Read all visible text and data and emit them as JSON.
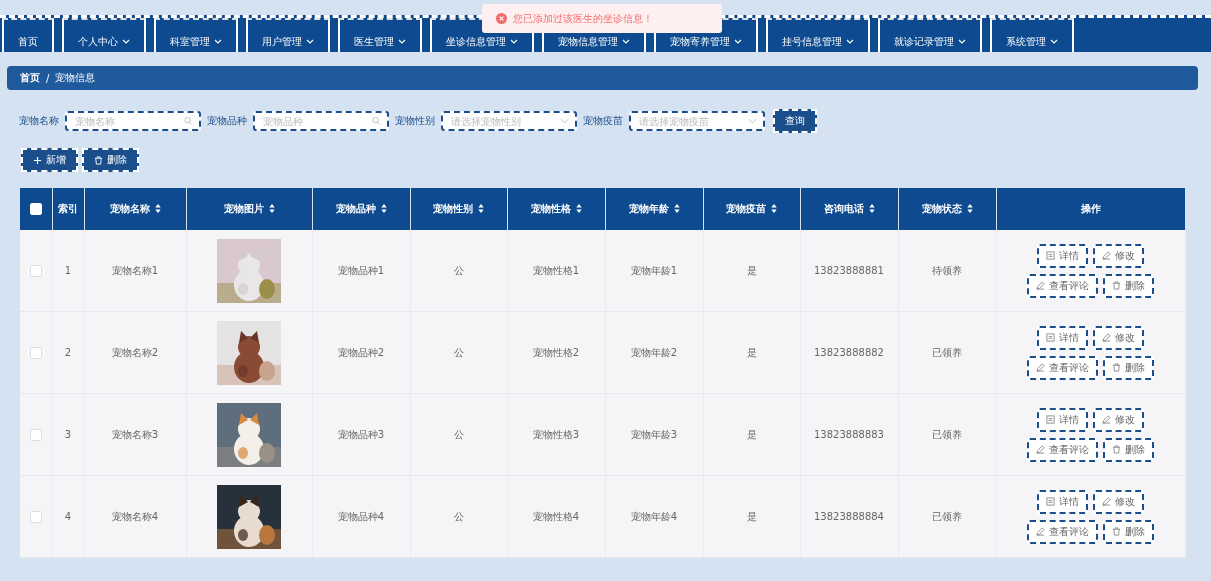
{
  "nav": [
    {
      "label": "首页",
      "has_menu": false
    },
    {
      "label": "个人中心",
      "has_menu": true
    },
    {
      "label": "科室管理",
      "has_menu": true
    },
    {
      "label": "用户管理",
      "has_menu": true
    },
    {
      "label": "医生管理",
      "has_menu": true
    },
    {
      "label": "坐诊信息管理",
      "has_menu": true
    },
    {
      "label": "宠物信息管理",
      "has_menu": true
    },
    {
      "label": "宠物寄养管理",
      "has_menu": true
    },
    {
      "label": "挂号信息管理",
      "has_menu": true
    },
    {
      "label": "就诊记录管理",
      "has_menu": true
    },
    {
      "label": "系统管理",
      "has_menu": true
    }
  ],
  "toast": {
    "kind": "error",
    "message": "您已添加过该医生的坐诊信息！"
  },
  "breadcrumb": {
    "items": [
      "首页",
      "宠物信息"
    ],
    "separator": "/"
  },
  "search": {
    "fields": [
      {
        "label": "宠物名称",
        "placeholder": "宠物名称",
        "kind": "text"
      },
      {
        "label": "宠物品种",
        "placeholder": "宠物品种",
        "kind": "text"
      },
      {
        "label": "宠物性别",
        "placeholder": "请选择宠物性别",
        "kind": "select"
      },
      {
        "label": "宠物疫苗",
        "placeholder": "请选择宠物疫苗",
        "kind": "select"
      }
    ],
    "button": "查询"
  },
  "actions": [
    "新增",
    "删除"
  ],
  "table": {
    "select_all": {
      "checked": false
    },
    "columns": [
      {
        "label": "索引",
        "sortable": false
      },
      {
        "label": "宠物名称",
        "sortable": true
      },
      {
        "label": "宠物图片",
        "sortable": true
      },
      {
        "label": "宠物品种",
        "sortable": true
      },
      {
        "label": "宠物性别",
        "sortable": true
      },
      {
        "label": "宠物性格",
        "sortable": true
      },
      {
        "label": "宠物年龄",
        "sortable": true
      },
      {
        "label": "宠物疫苗",
        "sortable": true
      },
      {
        "label": "咨询电话",
        "sortable": true
      },
      {
        "label": "宠物状态",
        "sortable": true
      },
      {
        "label": "操作",
        "sortable": false
      }
    ],
    "rows": [
      {
        "checked": false,
        "cells": [
          "1",
          "宠物名称1",
          {
            "kind": "picture"
          },
          "宠物品种1",
          "公",
          "宠物性格1",
          "宠物年龄1",
          "是",
          "13823888881",
          "待领养"
        ],
        "actions": [
          "详情",
          "修改",
          "查看评论",
          "删除"
        ]
      },
      {
        "checked": false,
        "cells": [
          "2",
          "宠物名称2",
          {
            "kind": "picture"
          },
          "宠物品种2",
          "公",
          "宠物性格2",
          "宠物年龄2",
          "是",
          "13823888882",
          "已领养"
        ],
        "actions": [
          "详情",
          "修改",
          "查看评论",
          "删除"
        ]
      },
      {
        "checked": false,
        "cells": [
          "3",
          "宠物名称3",
          {
            "kind": "picture"
          },
          "宠物品种3",
          "公",
          "宠物性格3",
          "宠物年龄3",
          "是",
          "13823888883",
          "已领养"
        ],
        "actions": [
          "详情",
          "修改",
          "查看评论",
          "删除"
        ]
      },
      {
        "checked": false,
        "cells": [
          "4",
          "宠物名称4",
          {
            "kind": "picture"
          },
          "宠物品种4",
          "公",
          "宠物性格4",
          "宠物年龄4",
          "是",
          "13823888884",
          "已领养"
        ],
        "actions": [
          "详情",
          "修改",
          "查看评论",
          "删除"
        ]
      }
    ]
  }
}
